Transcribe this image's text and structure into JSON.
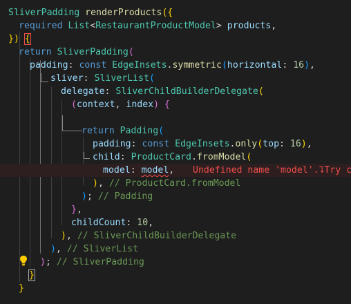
{
  "editor": {
    "lines": [
      {
        "id": "l1",
        "tokens": [
          [
            "t",
            "SliverPadding"
          ],
          [
            "p",
            " "
          ],
          [
            "f",
            "renderProducts"
          ],
          [
            "b1",
            "({"
          ]
        ]
      },
      {
        "id": "l2",
        "tokens": [
          [
            "k",
            "required"
          ],
          [
            "p",
            " "
          ],
          [
            "t",
            "List"
          ],
          [
            "p",
            "<"
          ],
          [
            "t",
            "RestaurantProductModel"
          ],
          [
            "p",
            "> "
          ],
          [
            "v",
            "products"
          ],
          [
            "p",
            ","
          ]
        ]
      },
      {
        "id": "l3",
        "tokens": [
          [
            "b1",
            "})"
          ],
          [
            "p",
            " "
          ],
          [
            "b1",
            "{"
          ]
        ]
      },
      {
        "id": "l4",
        "tokens": [
          [
            "k",
            "return"
          ],
          [
            "p",
            " "
          ],
          [
            "t",
            "SliverPadding"
          ],
          [
            "b2",
            "("
          ]
        ]
      },
      {
        "id": "l5",
        "tokens": [
          [
            "v",
            "padding"
          ],
          [
            "p",
            ": "
          ],
          [
            "k",
            "const"
          ],
          [
            "p",
            " "
          ],
          [
            "t",
            "EdgeInsets"
          ],
          [
            "p",
            "."
          ],
          [
            "f",
            "symmetric"
          ],
          [
            "b3",
            "("
          ],
          [
            "v",
            "horizontal"
          ],
          [
            "p",
            ": "
          ],
          [
            "n",
            "16"
          ],
          [
            "b3",
            ")"
          ],
          [
            "p",
            ","
          ]
        ]
      },
      {
        "id": "l6",
        "tokens": [
          [
            "v",
            "sliver"
          ],
          [
            "p",
            ": "
          ],
          [
            "t",
            "SliverList"
          ],
          [
            "b3",
            "("
          ]
        ]
      },
      {
        "id": "l7",
        "tokens": [
          [
            "v",
            "delegate"
          ],
          [
            "p",
            ": "
          ],
          [
            "t",
            "SliverChildBuilderDelegate"
          ],
          [
            "b1",
            "("
          ]
        ]
      },
      {
        "id": "l8",
        "tokens": [
          [
            "b2",
            "("
          ],
          [
            "v",
            "context"
          ],
          [
            "p",
            ", "
          ],
          [
            "v",
            "index"
          ],
          [
            "b2",
            ")"
          ],
          [
            "p",
            " "
          ],
          [
            "b2",
            "{"
          ]
        ]
      },
      {
        "id": "l9",
        "tokens": []
      },
      {
        "id": "l10",
        "tokens": [
          [
            "k",
            "return"
          ],
          [
            "p",
            " "
          ],
          [
            "t",
            "Padding"
          ],
          [
            "b3",
            "("
          ]
        ]
      },
      {
        "id": "l11",
        "tokens": [
          [
            "v",
            "padding"
          ],
          [
            "p",
            ": "
          ],
          [
            "k",
            "const"
          ],
          [
            "p",
            " "
          ],
          [
            "t",
            "EdgeInsets"
          ],
          [
            "p",
            "."
          ],
          [
            "f",
            "only"
          ],
          [
            "b1",
            "("
          ],
          [
            "v",
            "top"
          ],
          [
            "p",
            ": "
          ],
          [
            "n",
            "16"
          ],
          [
            "b1",
            ")"
          ],
          [
            "p",
            ","
          ]
        ]
      },
      {
        "id": "l12",
        "tokens": [
          [
            "v",
            "child"
          ],
          [
            "p",
            ": "
          ],
          [
            "t",
            "ProductCard"
          ],
          [
            "p",
            "."
          ],
          [
            "f",
            "fromModel"
          ],
          [
            "b1",
            "("
          ]
        ]
      },
      {
        "id": "l13",
        "tokens": [
          [
            "v",
            "model"
          ],
          [
            "p",
            ": "
          ],
          [
            "sq",
            "model"
          ],
          [
            "p",
            ","
          ]
        ]
      },
      {
        "id": "l14",
        "tokens": [
          [
            "b1",
            ")"
          ],
          [
            "p",
            ", "
          ],
          [
            "c",
            "// ProductCard.fromModel"
          ]
        ]
      },
      {
        "id": "l15",
        "tokens": [
          [
            "b3",
            ")"
          ],
          [
            "p",
            "; "
          ],
          [
            "c",
            "// Padding"
          ]
        ]
      },
      {
        "id": "l16",
        "tokens": [
          [
            "b2",
            "}"
          ],
          [
            "p",
            ","
          ]
        ]
      },
      {
        "id": "l17",
        "tokens": [
          [
            "v",
            "childCount"
          ],
          [
            "p",
            ": "
          ],
          [
            "n",
            "10"
          ],
          [
            "p",
            ","
          ]
        ]
      },
      {
        "id": "l18",
        "tokens": [
          [
            "b1",
            ")"
          ],
          [
            "p",
            ", "
          ],
          [
            "c",
            "// SliverChildBuilderDelegate"
          ]
        ]
      },
      {
        "id": "l19",
        "tokens": [
          [
            "b3",
            ")"
          ],
          [
            "p",
            ", "
          ],
          [
            "c",
            "// SliverList"
          ]
        ]
      },
      {
        "id": "l20",
        "tokens": [
          [
            "b2",
            ")"
          ],
          [
            "p",
            "; "
          ],
          [
            "c",
            "// SliverPadding"
          ]
        ]
      },
      {
        "id": "l21",
        "tokens": [
          [
            "b1",
            "}"
          ]
        ]
      },
      {
        "id": "l22",
        "tokens": [
          [
            "b1",
            "}"
          ]
        ]
      }
    ],
    "inline_error": "Undefined name 'model'.⮧Try co",
    "lightbulb_icon": "lightbulb-icon",
    "colors": {
      "background": "#1e1e1e",
      "keyword": "#569cd6",
      "type": "#4ec9b0",
      "function": "#dcdcaa",
      "variable": "#9cdcfe",
      "number": "#b5cea8",
      "comment": "#6a9955",
      "error": "#f14c4c"
    }
  }
}
